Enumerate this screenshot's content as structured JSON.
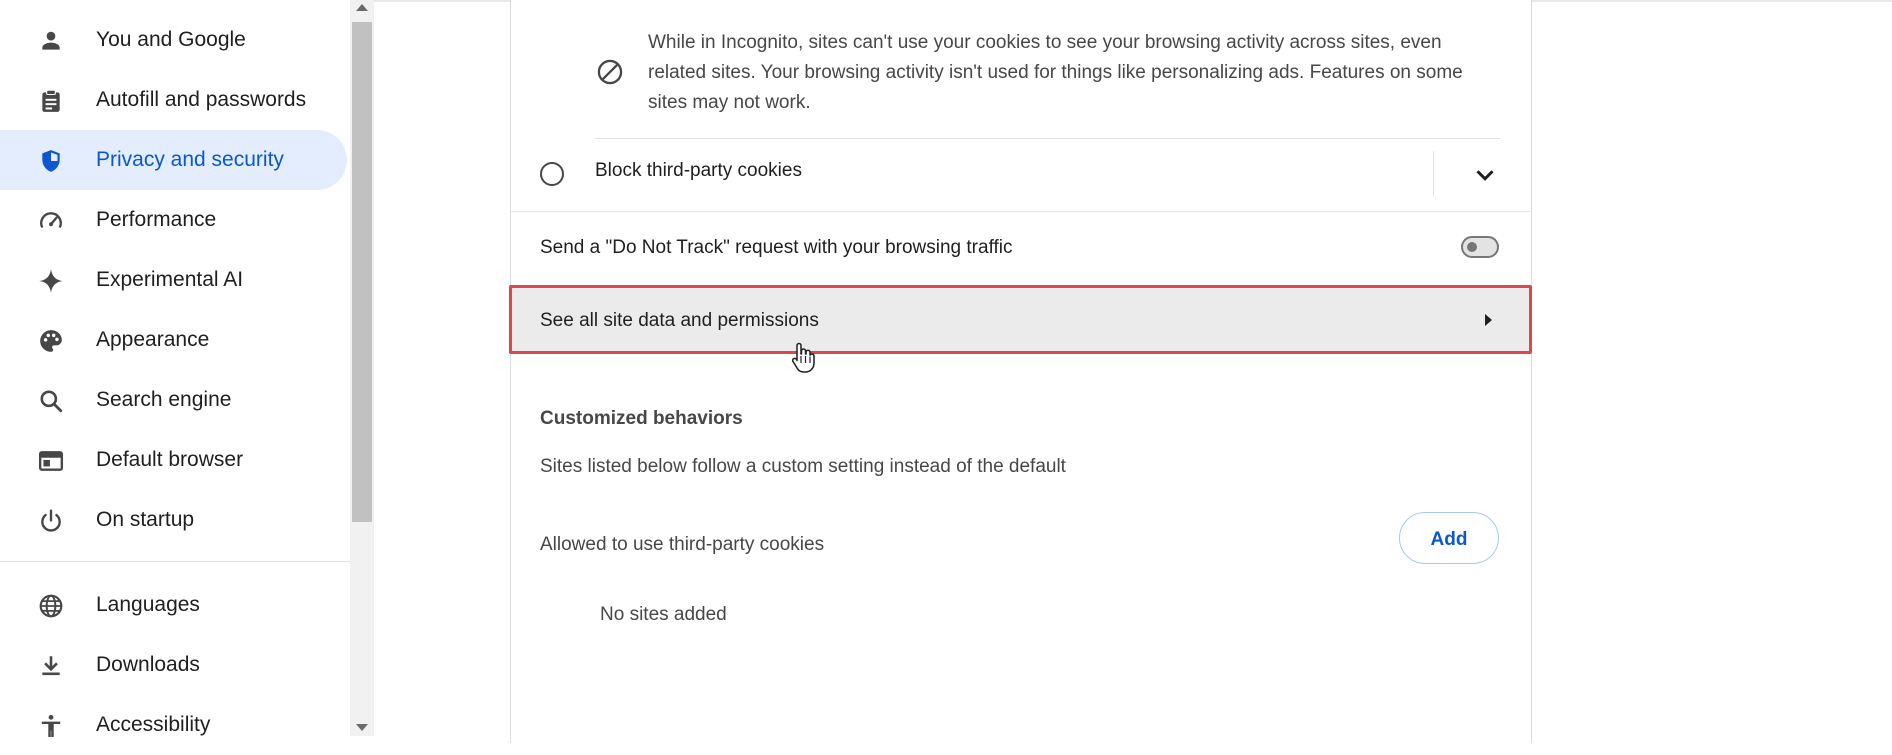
{
  "sidebar": {
    "items": [
      {
        "label": "You and Google",
        "icon": "person-icon"
      },
      {
        "label": "Autofill and passwords",
        "icon": "clipboard-icon"
      },
      {
        "label": "Privacy and security",
        "icon": "shield-icon",
        "active": true
      },
      {
        "label": "Performance",
        "icon": "speedometer-icon"
      },
      {
        "label": "Experimental AI",
        "icon": "sparkle-icon"
      },
      {
        "label": "Appearance",
        "icon": "palette-icon"
      },
      {
        "label": "Search engine",
        "icon": "search-icon"
      },
      {
        "label": "Default browser",
        "icon": "browser-window-icon"
      },
      {
        "label": "On startup",
        "icon": "power-icon"
      },
      {
        "label": "Languages",
        "icon": "globe-icon"
      },
      {
        "label": "Downloads",
        "icon": "download-icon"
      },
      {
        "label": "Accessibility",
        "icon": "accessibility-icon"
      }
    ]
  },
  "main": {
    "incognito_text": "While in Incognito, sites can't use your cookies to see your browsing activity across sites, even related sites. Your browsing activity isn't used for things like personalizing ads. Features on some sites may not work.",
    "block_third_party_label": "Block third-party cookies",
    "do_not_track_label": "Send a \"Do Not Track\" request with your browsing traffic",
    "do_not_track_enabled": false,
    "site_data_label": "See all site data and permissions",
    "customized_title": "Customized behaviors",
    "customized_desc": "Sites listed below follow a custom setting instead of the default",
    "allowed_label": "Allowed to use third-party cookies",
    "add_button": "Add",
    "no_sites": "No sites added"
  },
  "colors": {
    "accent": "#0b57d0",
    "active_bg": "#e3edfd",
    "highlight_outline": "#e0474a"
  }
}
